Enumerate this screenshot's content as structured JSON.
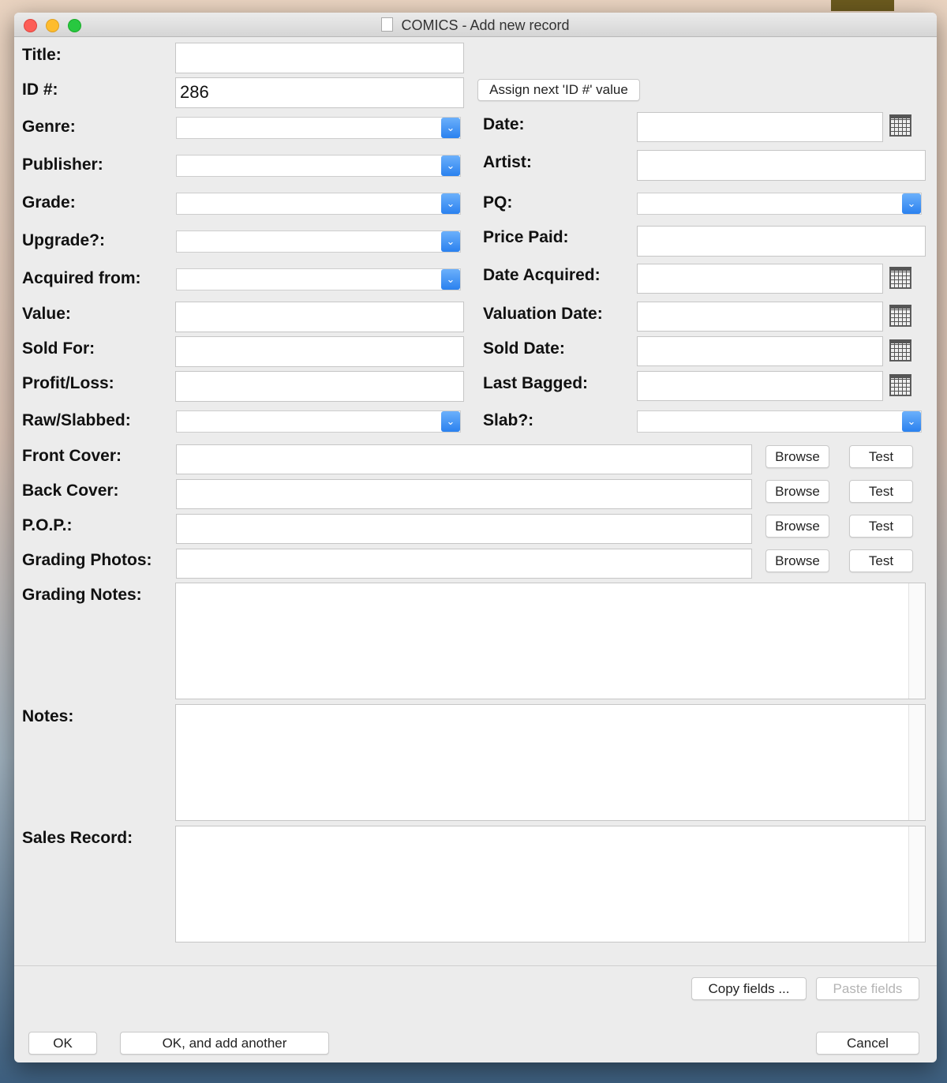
{
  "window": {
    "title": "COMICS - Add new record"
  },
  "fields": {
    "title_label": "Title:",
    "id_label": "ID #:",
    "id_value": "286",
    "assign_button": "Assign next 'ID #' value",
    "genre_label": "Genre:",
    "date_label": "Date:",
    "publisher_label": "Publisher:",
    "artist_label": "Artist:",
    "grade_label": "Grade:",
    "pq_label": "PQ:",
    "upgrade_label": "Upgrade?:",
    "price_paid_label": "Price Paid:",
    "acquired_from_label": "Acquired from:",
    "date_acquired_label": "Date Acquired:",
    "value_label": "Value:",
    "valuation_date_label": "Valuation Date:",
    "sold_for_label": "Sold For:",
    "sold_date_label": "Sold Date:",
    "profit_loss_label": "Profit/Loss:",
    "last_bagged_label": "Last Bagged:",
    "raw_slabbed_label": "Raw/Slabbed:",
    "slab_label": "Slab?:",
    "front_cover_label": "Front Cover:",
    "back_cover_label": "Back Cover:",
    "pop_label": "P.O.P.:",
    "grading_photos_label": "Grading Photos:",
    "grading_notes_label": "Grading Notes:",
    "notes_label": "Notes:",
    "sales_record_label": "Sales Record:"
  },
  "buttons": {
    "browse": "Browse",
    "test": "Test",
    "copy_fields": "Copy fields ...",
    "paste_fields": "Paste fields",
    "ok": "OK",
    "ok_add_another": "OK, and add another",
    "cancel": "Cancel"
  },
  "colors": {
    "accent": "#2a81ef"
  }
}
